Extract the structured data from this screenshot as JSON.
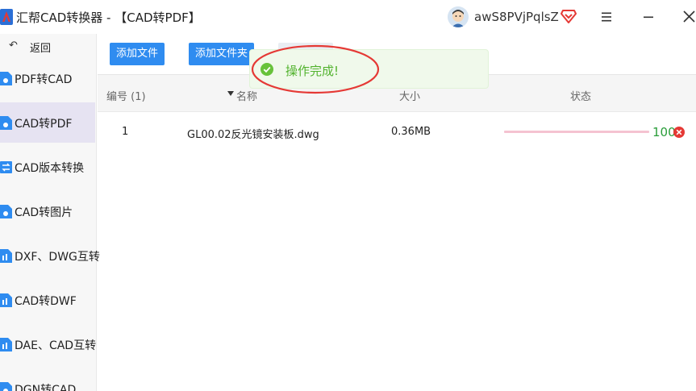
{
  "window": {
    "title": "汇帮CAD转换器 - 【CAD转PDF】",
    "username": "awS8PVjPqlsZ"
  },
  "sidebar": {
    "back_label": "返回",
    "items": [
      {
        "label": "PDF转CAD",
        "active": false
      },
      {
        "label": "CAD转PDF",
        "active": true
      },
      {
        "label": "CAD版本转换",
        "active": false
      },
      {
        "label": "CAD转图片",
        "active": false
      },
      {
        "label": "DXF、DWG互转",
        "active": false
      },
      {
        "label": "CAD转DWF",
        "active": false
      },
      {
        "label": "DAE、CAD互转",
        "active": false
      },
      {
        "label": "DGN转CAD",
        "active": false
      }
    ]
  },
  "toolbar": {
    "add_file_label": "添加文件",
    "add_folder_label": "添加文件夹"
  },
  "table": {
    "headers": {
      "index": "编号 (1)",
      "name": "名称",
      "size": "大小",
      "status": "状态"
    },
    "rows": [
      {
        "index": "1",
        "name": "GL00.02反光镜安装板.dwg",
        "size": "0.36MB",
        "progress": 100,
        "progress_text": "100"
      }
    ]
  },
  "toast": {
    "message": "操作完成!"
  },
  "colors": {
    "accent": "#2f8cf0",
    "active_nav_bg": "#e6e3f2",
    "progress": "#f5c3d1",
    "success": "#52b32e",
    "annotation": "#e53935"
  }
}
